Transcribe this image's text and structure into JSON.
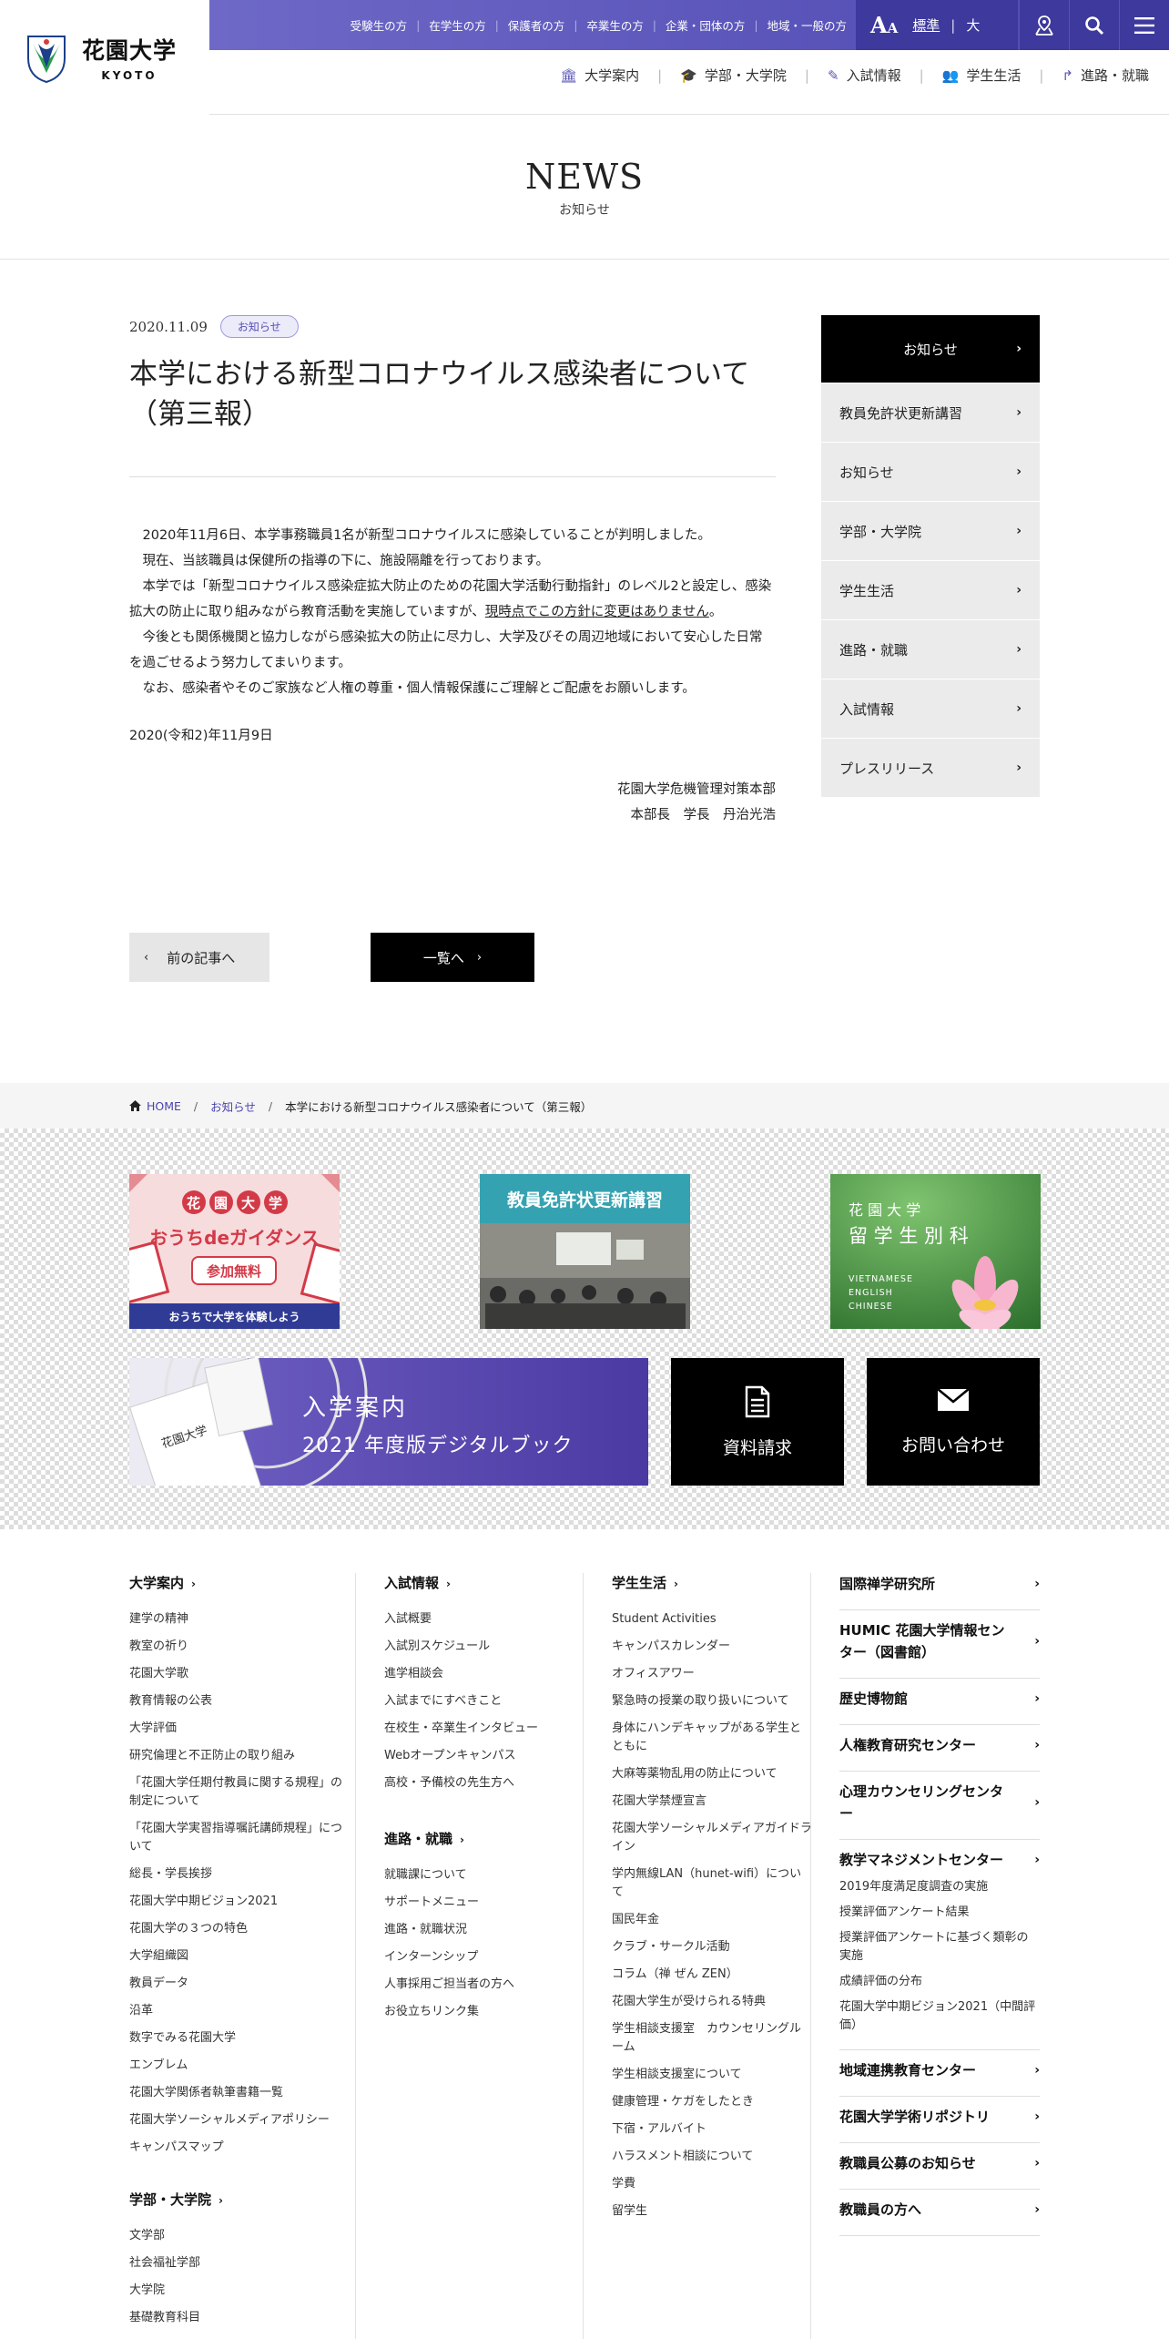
{
  "header": {
    "logo_text": "花園大学",
    "logo_sub": "KYOTO",
    "audience_links": [
      "受験生の方",
      "在学生の方",
      "保護者の方",
      "卒業生の方",
      "企業・団体の方",
      "地域・一般の方"
    ],
    "font_size": {
      "standard": "標準",
      "separator": "|",
      "large": "大"
    },
    "main_nav": [
      {
        "label": "大学案内",
        "icon": "building-icon"
      },
      {
        "label": "学部・大学院",
        "icon": "graduation-cap-icon"
      },
      {
        "label": "入試情報",
        "icon": "pencil-icon"
      },
      {
        "label": "学生生活",
        "icon": "people-icon"
      },
      {
        "label": "進路・就職",
        "icon": "arrow-turn-icon"
      }
    ]
  },
  "page_title": {
    "en": "NEWS",
    "ja": "お知らせ"
  },
  "article": {
    "date": "2020.11.09",
    "category": "お知らせ",
    "title": "本学における新型コロナウイルス感染者について（第三報）",
    "p1": "2020年11月6日、本学事務職員1名が新型コロナウイルスに感染していることが判明しました。",
    "p2": "現在、当該職員は保健所の指導の下に、施設隔離を行っております。",
    "p3a": "本学では「新型コロナウイルス感染症拡大防止のための花園大学活動行動指針」のレベル2と設定し、感染拡大の防止に取り組みながら教育活動を実施していますが、",
    "p3u": "現時点でこの方針に変更はありません",
    "p3b": "。",
    "p4": "今後とも関係機関と協力しながら感染拡大の防止に尽力し、大学及びその周辺地域において安心した日常を過ごせるよう努力してまいります。",
    "p5": "なお、感染者やそのご家族など人権の尊重・個人情報保護にご理解とご配慮をお願いします。",
    "issue_date": "2020(令和2)年11月9日",
    "sign1": "花園大学危機管理対策本部",
    "sign2": "本部長　学長　丹治光浩"
  },
  "side_nav": [
    {
      "label": "お知らせ",
      "active": true
    },
    {
      "label": "教員免許状更新講習"
    },
    {
      "label": "お知らせ"
    },
    {
      "label": "学部・大学院"
    },
    {
      "label": "学生生活"
    },
    {
      "label": "進路・就職"
    },
    {
      "label": "入試情報"
    },
    {
      "label": "プレスリリース"
    }
  ],
  "pager": {
    "prev": "前の記事へ",
    "list": "一覧へ"
  },
  "breadcrumb": {
    "home": "HOME",
    "cat": "お知らせ",
    "current": "本学における新型コロナウイルス感染者について（第三報）",
    "sep": "/"
  },
  "banners": {
    "ouchi": {
      "line1": [
        "花",
        "園",
        "大",
        "学"
      ],
      "line2": "おうちdeガイダンス",
      "btn": "参加無料",
      "foot": "おうちで大学を体験しよう"
    },
    "kyoin": {
      "title": "教員免許状更新講習"
    },
    "ryugaku": {
      "l1": "花 園 大 学",
      "l2": "留 学 生 別 科",
      "langs": [
        "VIETNAMESE",
        "ENGLISH",
        "CHINESE"
      ]
    },
    "digital": {
      "book": "花園大学",
      "l1": "入学案内",
      "l2": "2021 年度版デジタルブック"
    },
    "request": "資料請求",
    "contact": "お問い合わせ"
  },
  "footer": {
    "col1": {
      "title": "大学案内",
      "items": [
        "建学の精神",
        "教室の祈り",
        "花園大学歌",
        "教育情報の公表",
        "大学評価",
        "研究倫理と不正防止の取り組み",
        "「花園大学任期付教員に関する規程」の制定について",
        "「花園大学実習指導嘱託講師規程」について",
        "総長・学長挨拶",
        "花園大学中期ビジョン2021",
        "花園大学の３つの特色",
        "大学組織図",
        "教員データ",
        "沿革",
        "数字でみる花園大学",
        "エンブレム",
        "花園大学関係者執筆書籍一覧",
        "花園大学ソーシャルメディアポリシー",
        "キャンパスマップ"
      ],
      "title2": "学部・大学院",
      "items2": [
        "文学部",
        "社会福祉学部",
        "大学院",
        "基礎教育科目"
      ]
    },
    "col2": {
      "title": "入試情報",
      "items": [
        "入試概要",
        "入試別スケジュール",
        "進学相談会",
        "入試までにすべきこと",
        "在校生・卒業生インタビュー",
        "Webオープンキャンパス",
        "高校・予備校の先生方へ"
      ],
      "title2": "進路・就職",
      "items2": [
        "就職課について",
        "サポートメニュー",
        "進路・就職状況",
        "インターンシップ",
        "人事採用ご担当者の方へ",
        "お役立ちリンク集"
      ]
    },
    "col3": {
      "title": "学生生活",
      "items": [
        "Student Activities",
        "キャンパスカレンダー",
        "オフィスアワー",
        "緊急時の授業の取り扱いについて",
        "身体にハンデキャップがある学生とともに",
        "大麻等薬物乱用の防止について",
        "花園大学禁煙宣言",
        "花園大学ソーシャルメディアガイドライン",
        "学内無線LAN（hunet-wifi）について",
        "国民年金",
        "クラブ・サークル活動",
        "コラム（禅 ぜん ZEN）",
        "花園大学生が受けられる特典",
        "学生相談支援室　カウンセリングルーム",
        "学生相談支援室について",
        "健康管理・ケガをしたとき",
        "下宿・アルバイト",
        "ハラスメント相談について",
        "学費",
        "留学生"
      ]
    },
    "col4": [
      {
        "title": "国際禅学研究所"
      },
      {
        "title": "HUMIC 花園大学情報センター（図書館）"
      },
      {
        "title": "歴史博物館"
      },
      {
        "title": "人権教育研究センター"
      },
      {
        "title": "心理カウンセリングセンター"
      },
      {
        "title": "教学マネジメントセンター",
        "subs": [
          "2019年度満足度調査の実施",
          "授業評価アンケート結果",
          "授業評価アンケートに基づく類彰の実施",
          "成績評価の分布",
          "花園大学中期ビジョン2021（中間評価）"
        ]
      },
      {
        "title": "地域連携教育センター"
      },
      {
        "title": "花園大学学術リポジトリ"
      },
      {
        "title": "教職員公募のお知らせ"
      },
      {
        "title": "教職員の方へ"
      }
    ]
  },
  "colors": {
    "brand": "#4e48b1",
    "brand_dark": "#3e399c",
    "accent_link": "#4a44ab"
  }
}
